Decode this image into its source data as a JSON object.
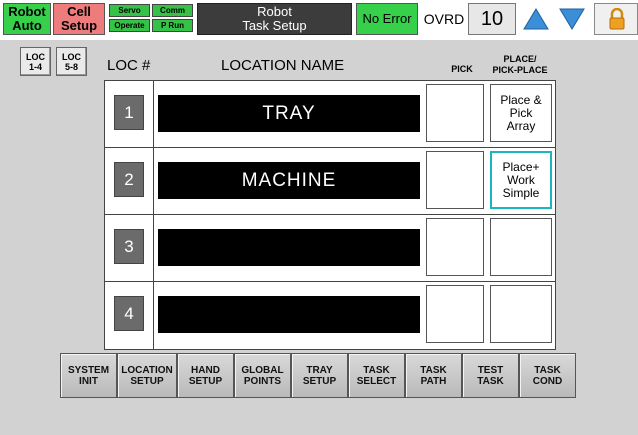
{
  "status_bar": {
    "robot_mode": "Robot\nAuto",
    "cell_mode": "Cell\nSetup",
    "servo": "Servo",
    "comm": "Comm",
    "operate": "Operate",
    "p_run": "P Run",
    "screen_title": "Robot\nTask Setup",
    "error_status": "No Error",
    "ovrd_label": "OVRD",
    "ovrd_value": "10",
    "colors": {
      "green": "#37d04a",
      "red": "#ef7c7c",
      "dark": "#3c3c3c",
      "arrow_blue": "#3a8fd8",
      "lock_orange": "#f0a020"
    }
  },
  "header": {
    "loc_1_4": "LOC\n1-4",
    "loc_5_8": "LOC\n5-8",
    "loc_num": "LOC #",
    "location_name": "LOCATION NAME",
    "pick": "PICK",
    "place": "PLACE/\nPICK-PLACE"
  },
  "locations": [
    {
      "num": "1",
      "name": "TRAY",
      "place_mode": "Place &\nPick\nArray"
    },
    {
      "num": "2",
      "name": "MACHINE",
      "place_mode": "Place+\nWork\nSimple"
    },
    {
      "num": "3",
      "name": "",
      "place_mode": ""
    },
    {
      "num": "4",
      "name": "",
      "place_mode": ""
    }
  ],
  "nav": [
    "SYSTEM\nINIT",
    "LOCATION\nSETUP",
    "HAND\nSETUP",
    "GLOBAL\nPOINTS",
    "TRAY\nSETUP",
    "TASK\nSELECT",
    "TASK\nPATH",
    "TEST\nTASK",
    "TASK\nCOND"
  ]
}
